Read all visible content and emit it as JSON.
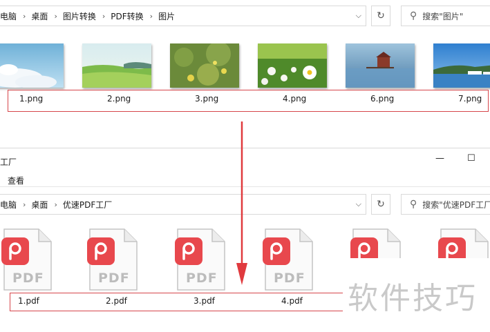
{
  "top_window": {
    "breadcrumb": [
      "电脑",
      "桌面",
      "图片转换",
      "PDF转换",
      "图片"
    ],
    "search_placeholder": "搜索\"图片\"",
    "files": [
      {
        "name": "1.png",
        "thumb": "sky-clouds"
      },
      {
        "name": "2.png",
        "thumb": "green-field"
      },
      {
        "name": "3.png",
        "thumb": "yellow-flowers"
      },
      {
        "name": "4.png",
        "thumb": "daisy-meadow"
      },
      {
        "name": "6.png",
        "thumb": "lake-cabin"
      },
      {
        "name": "7.png",
        "thumb": "harbor-boats"
      }
    ]
  },
  "bottom_window": {
    "title": "工厂",
    "menu": [
      "查看"
    ],
    "breadcrumb": [
      "电脑",
      "桌面",
      "优速PDF工厂"
    ],
    "search_placeholder": "搜索\"优速PDF工厂\"",
    "pdf_icon_label": "PDF",
    "files": [
      {
        "name": "1.pdf"
      },
      {
        "name": "2.pdf"
      },
      {
        "name": "3.pdf"
      },
      {
        "name": "4.pdf"
      }
    ]
  },
  "watermark": "软件技巧",
  "colors": {
    "highlight_box": "#d6454a",
    "arrow": "#e03a3e",
    "pdf_badge": "#e8484d"
  }
}
